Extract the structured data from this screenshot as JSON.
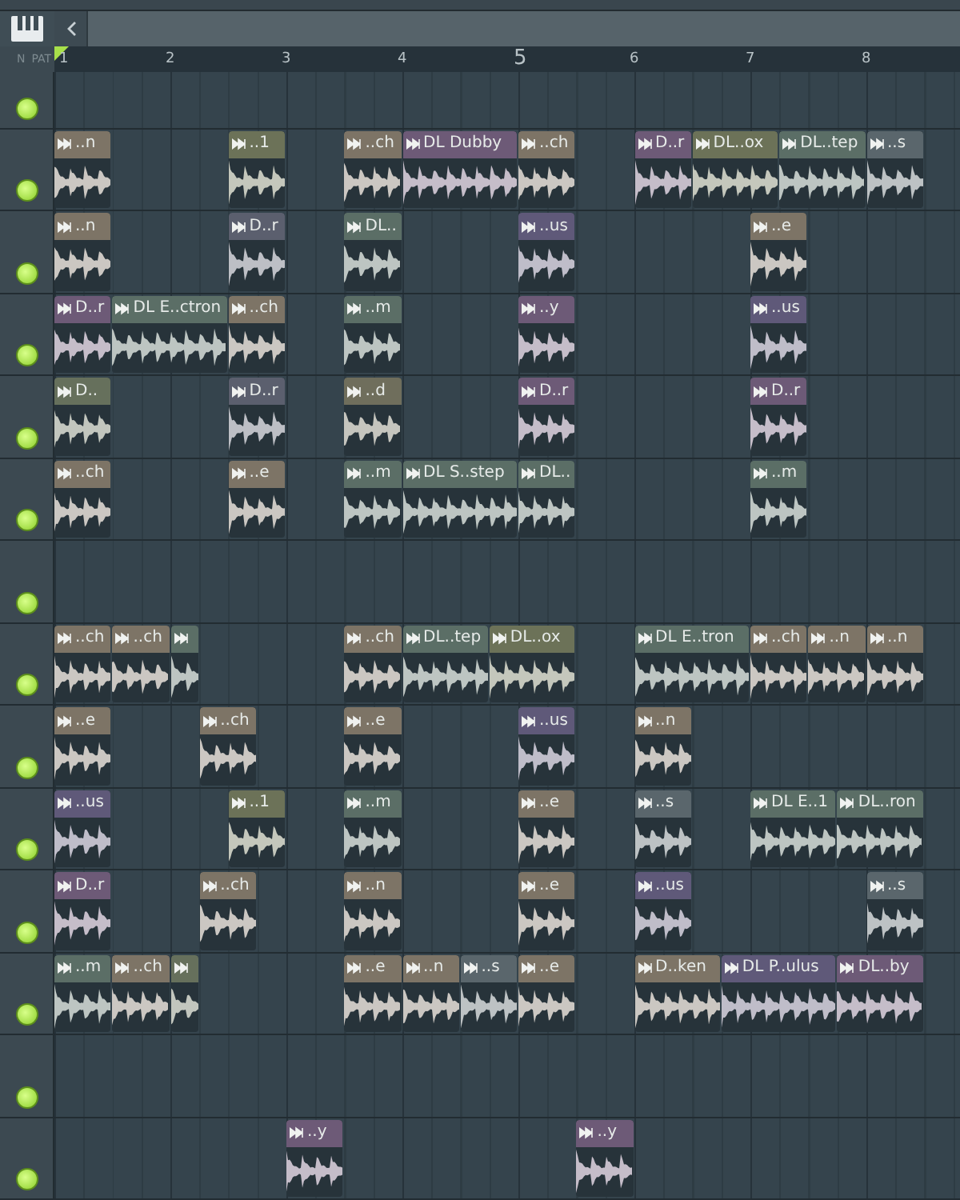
{
  "corner": {
    "labels": [
      "N",
      "PAT"
    ]
  },
  "ruler": {
    "bars": [
      {
        "label": "1",
        "emphasized": false
      },
      {
        "label": "2",
        "emphasized": false
      },
      {
        "label": "3",
        "emphasized": false
      },
      {
        "label": "4",
        "emphasized": false
      },
      {
        "label": "5",
        "emphasized": true
      },
      {
        "label": "6",
        "emphasized": false
      },
      {
        "label": "7",
        "emphasized": false
      },
      {
        "label": "8",
        "emphasized": false
      }
    ]
  },
  "tracks": [
    {
      "on": true
    },
    {
      "on": true,
      "items": [
        {
          "kind": "clip2",
          "name": "..n",
          "color": "#7d7466"
        },
        {
          "kind": "gap4"
        },
        {
          "kind": "clip2",
          "name": "..1",
          "color": "#6c7258"
        },
        {
          "kind": "gap2"
        },
        {
          "kind": "clip2",
          "name": "..ch",
          "color": "#7d7466"
        },
        {
          "kind": "clip4",
          "name": "DL Dubby",
          "color": "#6d5a77"
        },
        {
          "kind": "clip2",
          "name": "..ch",
          "color": "#7d7466"
        },
        {
          "kind": "gap2"
        },
        {
          "kind": "clip2",
          "name": "D..r",
          "color": "#6d5a77"
        },
        {
          "kind": "clip3",
          "name": "DL..ox",
          "color": "#6c7258"
        },
        {
          "kind": "clip3",
          "name": "DL..tep",
          "color": "#5b6e66"
        },
        {
          "kind": "clip2",
          "name": "..s",
          "color": "#5a666c"
        }
      ]
    },
    {
      "on": true,
      "items": [
        {
          "kind": "clip2",
          "name": "..n",
          "color": "#7d7466"
        },
        {
          "kind": "gap4"
        },
        {
          "kind": "clip2",
          "name": "D..r",
          "color": "#5b5f6e"
        },
        {
          "kind": "gap2"
        },
        {
          "kind": "clip2",
          "name": "DL..",
          "color": "#5b6e66"
        },
        {
          "kind": "gap4"
        },
        {
          "kind": "clip2",
          "name": "..us",
          "color": "#5f5979"
        },
        {
          "kind": "gap6"
        },
        {
          "kind": "clip2",
          "name": "..e",
          "color": "#7d7466"
        }
      ]
    },
    {
      "on": true,
      "items": [
        {
          "kind": "clip2",
          "name": "D..r",
          "color": "#6d5a77"
        },
        {
          "kind": "clip4",
          "name": "DL E..ctron",
          "color": "#5b6e66"
        },
        {
          "kind": "clip2",
          "name": "..ch",
          "color": "#7d7466"
        },
        {
          "kind": "gap2"
        },
        {
          "kind": "clip2",
          "name": "..m",
          "color": "#5b6e66"
        },
        {
          "kind": "gap4"
        },
        {
          "kind": "clip2",
          "name": "..y",
          "color": "#6d5a77"
        },
        {
          "kind": "gap6"
        },
        {
          "kind": "clip2",
          "name": "..us",
          "color": "#5f5979"
        }
      ]
    },
    {
      "on": true,
      "items": [
        {
          "kind": "clip2",
          "name": "D..",
          "color": "#66705c"
        },
        {
          "kind": "gap4"
        },
        {
          "kind": "clip2",
          "name": "D..r",
          "color": "#5b5f6e"
        },
        {
          "kind": "gap2"
        },
        {
          "kind": "clip2",
          "name": "..d",
          "color": "#6f6e5c"
        },
        {
          "kind": "gap4"
        },
        {
          "kind": "clip2",
          "name": "D..r",
          "color": "#6d5a77"
        },
        {
          "kind": "gap6"
        },
        {
          "kind": "clip2",
          "name": "D..r",
          "color": "#6d5a77"
        }
      ]
    },
    {
      "on": true,
      "items": [
        {
          "kind": "clip2",
          "name": "..ch",
          "color": "#7d7466"
        },
        {
          "kind": "gap4"
        },
        {
          "kind": "clip2",
          "name": "..e",
          "color": "#7d7466"
        },
        {
          "kind": "gap2"
        },
        {
          "kind": "clip2",
          "name": "..m",
          "color": "#5b6e66"
        },
        {
          "kind": "clip4",
          "name": "DL S..step",
          "color": "#5b6e66"
        },
        {
          "kind": "clip2",
          "name": "DL..",
          "color": "#5b6e66"
        },
        {
          "kind": "gap6"
        },
        {
          "kind": "clip2",
          "name": "..m",
          "color": "#5b6e66"
        }
      ]
    },
    {
      "on": true
    },
    {
      "on": true,
      "items": [
        {
          "kind": "clip2",
          "name": "..ch",
          "color": "#7d7466"
        },
        {
          "kind": "clip2",
          "name": "..ch",
          "color": "#7d7466"
        },
        {
          "kind": "clip1",
          "color": "#5b6e66"
        },
        {
          "kind": "gap5"
        },
        {
          "kind": "clip2",
          "name": "..ch",
          "color": "#7d7466"
        },
        {
          "kind": "clip3",
          "name": "DL..tep",
          "color": "#5b6e66"
        },
        {
          "kind": "clip3",
          "name": "DL..ox",
          "color": "#6c7258"
        },
        {
          "kind": "gap2"
        },
        {
          "kind": "clip4",
          "name": "DL E..tron",
          "color": "#5b6e66"
        },
        {
          "kind": "clip2",
          "name": "..ch",
          "color": "#7d7466"
        },
        {
          "kind": "clip2",
          "name": "..n",
          "color": "#7d7466"
        },
        {
          "kind": "clip2",
          "name": "..n",
          "color": "#7d7466"
        }
      ]
    },
    {
      "on": true,
      "items": [
        {
          "kind": "clip2",
          "name": "..e",
          "color": "#7d7466"
        },
        {
          "kind": "gap3"
        },
        {
          "kind": "clip2",
          "name": "..ch",
          "color": "#7d7466"
        },
        {
          "kind": "gap3"
        },
        {
          "kind": "clip2",
          "name": "..e",
          "color": "#7d7466"
        },
        {
          "kind": "gap4"
        },
        {
          "kind": "clip2",
          "name": "..us",
          "color": "#5f5979"
        },
        {
          "kind": "gap2"
        },
        {
          "kind": "clip2",
          "name": "..n",
          "color": "#7d7466"
        }
      ]
    },
    {
      "on": true,
      "items": [
        {
          "kind": "clip2",
          "name": "..us",
          "color": "#5f5979"
        },
        {
          "kind": "gap4"
        },
        {
          "kind": "clip2",
          "name": "..1",
          "color": "#6c7258"
        },
        {
          "kind": "gap2"
        },
        {
          "kind": "clip2",
          "name": "..m",
          "color": "#5b6e66"
        },
        {
          "kind": "gap4"
        },
        {
          "kind": "clip2",
          "name": "..e",
          "color": "#7d7466"
        },
        {
          "kind": "gap2"
        },
        {
          "kind": "clip2",
          "name": "..s",
          "color": "#5a666c"
        },
        {
          "kind": "gap2"
        },
        {
          "kind": "clip3",
          "name": "DL E..1",
          "color": "#5b6e66"
        },
        {
          "kind": "clip3",
          "name": "DL..ron",
          "color": "#5b6e66"
        }
      ]
    },
    {
      "on": true,
      "items": [
        {
          "kind": "clip2",
          "name": "D..r",
          "color": "#6d5a77"
        },
        {
          "kind": "gap3"
        },
        {
          "kind": "clip2",
          "name": "..ch",
          "color": "#7d7466"
        },
        {
          "kind": "gap3"
        },
        {
          "kind": "clip2",
          "name": "..n",
          "color": "#7d7466"
        },
        {
          "kind": "gap4"
        },
        {
          "kind": "clip2",
          "name": "..e",
          "color": "#7d7466"
        },
        {
          "kind": "gap2"
        },
        {
          "kind": "clip2",
          "name": "..us",
          "color": "#5f5979"
        },
        {
          "kind": "gap6"
        },
        {
          "kind": "clip2",
          "name": "..s",
          "color": "#5a666c"
        }
      ]
    },
    {
      "on": true,
      "items": [
        {
          "kind": "clip2",
          "name": "..m",
          "color": "#5b6e66"
        },
        {
          "kind": "clip2",
          "name": "..ch",
          "color": "#7d7466"
        },
        {
          "kind": "clip1",
          "color": "#66705c"
        },
        {
          "kind": "gap5"
        },
        {
          "kind": "clip2",
          "name": "..e",
          "color": "#7d7466"
        },
        {
          "kind": "clip2",
          "name": "..n",
          "color": "#7d7466"
        },
        {
          "kind": "clip2",
          "name": "..s",
          "color": "#5a666c"
        },
        {
          "kind": "clip2",
          "name": "..e",
          "color": "#7d7466"
        },
        {
          "kind": "gap2"
        },
        {
          "kind": "clip3",
          "name": "D..ken",
          "color": "#7d7466"
        },
        {
          "kind": "clip4",
          "name": "DL P..ulus",
          "color": "#5f5979"
        },
        {
          "kind": "clip3",
          "name": "DL..by",
          "color": "#6d5a77"
        }
      ]
    },
    {
      "on": true
    },
    {
      "on": true,
      "items": [
        {
          "kind": "gap8"
        },
        {
          "kind": "clip2",
          "name": "..y",
          "color": "#6d5a77"
        },
        {
          "kind": "gap8"
        },
        {
          "kind": "clip2",
          "name": "..y",
          "color": "#6d5a77"
        }
      ]
    }
  ]
}
